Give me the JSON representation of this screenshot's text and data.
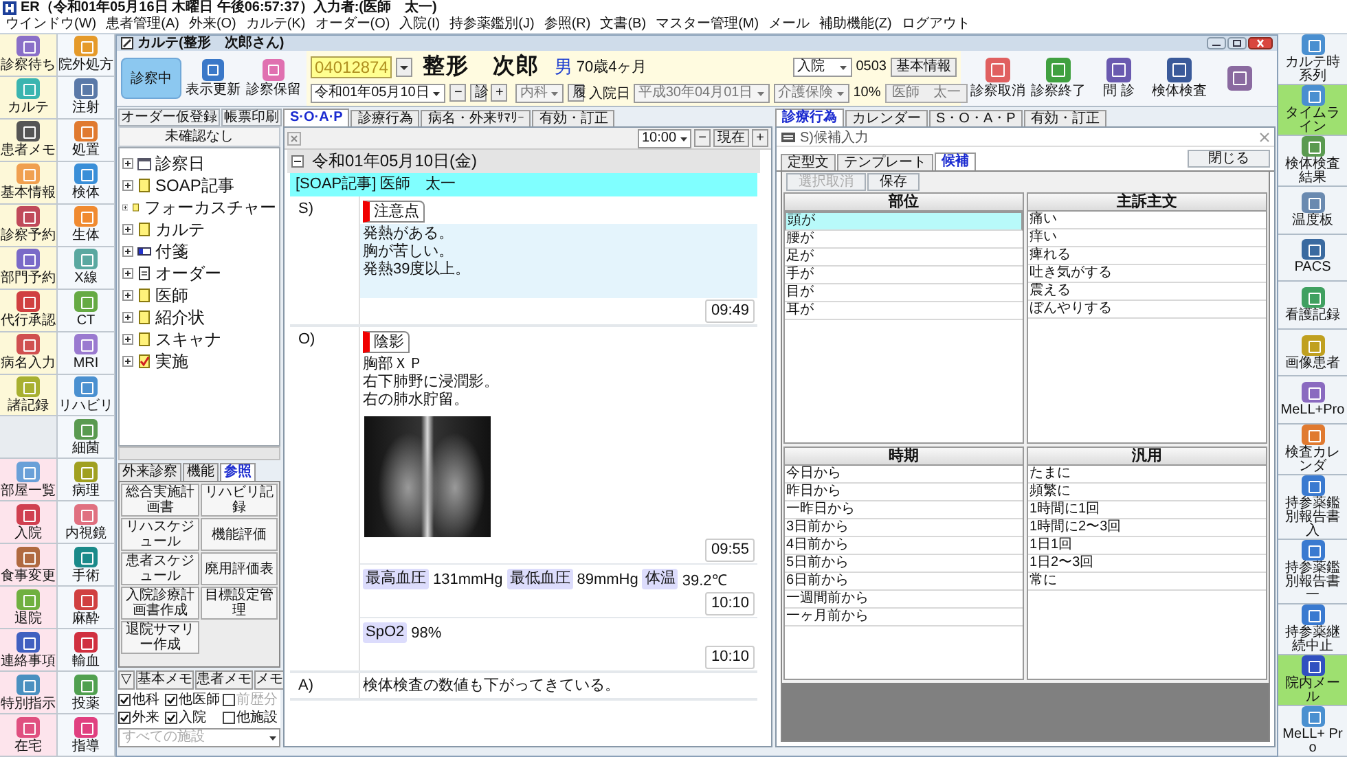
{
  "title_bar": {
    "title": "ER（令和01年05月16日 木曜日 午後06:57:37）入力者:(医師　太一)"
  },
  "menu": [
    "ウインドウ(W)",
    "患者管理(A)",
    "外来(O)",
    "カルテ(K)",
    "オーダー(O)",
    "入院(I)",
    "持参薬鑑別(J)",
    "参照(R)",
    "文書(B)",
    "マスター管理(M)",
    "メール",
    "補助機能(Z)",
    "ログアウト"
  ],
  "launcher_left": [
    {
      "label": "診察待ち",
      "kind": "outpatient",
      "color": "#8a6fc8"
    },
    {
      "label": "カルテ",
      "kind": "outpatient",
      "color": "#3bb5b0"
    },
    {
      "label": "患者メモ",
      "kind": "outpatient",
      "color": "#555555"
    },
    {
      "label": "基本情報",
      "kind": "outpatient",
      "color": "#f0a050"
    },
    {
      "label": "診察予約",
      "kind": "outpatient",
      "color": "#c04a5a"
    },
    {
      "label": "部門予約",
      "kind": "outpatient",
      "color": "#7a6ac8"
    },
    {
      "label": "代行承認",
      "kind": "outpatient",
      "color": "#d04040"
    },
    {
      "label": "病名入力",
      "kind": "outpatient",
      "color": "#d05050"
    },
    {
      "label": "諸記録",
      "kind": "outpatient",
      "color": "#a8b030"
    },
    {
      "kind": "blank"
    },
    {
      "label": "部屋一覧",
      "kind": "inpatient",
      "color": "#6aa0d8"
    },
    {
      "label": "入院",
      "kind": "inpatient",
      "color": "#d04050"
    },
    {
      "label": "食事変更",
      "kind": "inpatient",
      "color": "#b06a40"
    },
    {
      "label": "退院",
      "kind": "inpatient",
      "color": "#70b040"
    },
    {
      "label": "連絡事項",
      "kind": "inpatient",
      "color": "#4060c0"
    },
    {
      "label": "特別指示",
      "kind": "inpatient",
      "color": "#4a90c0"
    },
    {
      "label": "在宅",
      "kind": "inpatient",
      "color": "#e05080"
    },
    {
      "label": "院外処方",
      "kind": "order",
      "color": "#e59a2a"
    },
    {
      "label": "注射",
      "kind": "order",
      "color": "#5a79a8"
    },
    {
      "label": "処置",
      "kind": "order",
      "color": "#e07a30"
    },
    {
      "label": "検体",
      "kind": "order",
      "color": "#3a8fd8"
    },
    {
      "label": "生体",
      "kind": "order",
      "color": "#f08a30"
    },
    {
      "label": "X線",
      "kind": "order",
      "color": "#5aa8a0"
    },
    {
      "label": "CT",
      "kind": "order",
      "color": "#66aa44"
    },
    {
      "label": "MRI",
      "kind": "order",
      "color": "#9a7ad0"
    },
    {
      "label": "リハビリ",
      "kind": "order",
      "color": "#4a90d0"
    },
    {
      "label": "細菌",
      "kind": "order",
      "color": "#5a9a50"
    },
    {
      "label": "病理",
      "kind": "order",
      "color": "#a0a020"
    },
    {
      "label": "内視鏡",
      "kind": "order",
      "color": "#e07080"
    },
    {
      "label": "手術",
      "kind": "order",
      "color": "#1a8a8a"
    },
    {
      "label": "麻酔",
      "kind": "order",
      "color": "#d04040"
    },
    {
      "label": "輸血",
      "kind": "order",
      "color": "#d03040"
    },
    {
      "label": "投薬",
      "kind": "order",
      "color": "#50a050"
    },
    {
      "label": "指導",
      "kind": "order",
      "color": "#e04080"
    }
  ],
  "launcher_right": [
    {
      "label": "カルテ時系列",
      "color": "#4a8fd0",
      "highlighted": false
    },
    {
      "label": "タイムライン",
      "color": "#4a8fd0",
      "highlighted": true
    },
    {
      "label": "検体検査結果",
      "color": "#5a9a50",
      "highlighted": false
    },
    {
      "label": "温度板",
      "color": "#6a8ab0",
      "highlighted": false
    },
    {
      "label": "PACS",
      "color": "#3a6aa0",
      "highlighted": false
    },
    {
      "label": "看護記録",
      "color": "#40a060",
      "highlighted": false
    },
    {
      "label": "画像患者",
      "color": "#c0a020",
      "highlighted": false
    },
    {
      "label": "MeLL+Pro",
      "color": "#8a6ac0",
      "highlighted": false
    },
    {
      "label": "検査カレンダ",
      "color": "#e07a30",
      "highlighted": false
    },
    {
      "label": "持参薬鑑別報告書入",
      "color": "#3a7ad0",
      "highlighted": false
    },
    {
      "label": "持参薬鑑別報告書一",
      "color": "#3a7ad0",
      "highlighted": false
    },
    {
      "label": "持参薬継続中止",
      "color": "#3a7ad0",
      "highlighted": false
    },
    {
      "label": "院内メール",
      "color": "#3050c0",
      "highlighted": true
    },
    {
      "label": "MeLL+ Pro",
      "color": "#4a90d0",
      "highlighted": false
    }
  ],
  "chart_window": {
    "title": "カルテ(整形　次郎さん)"
  },
  "header": {
    "status_button": "診察中",
    "buttons": [
      {
        "label": "表示更新",
        "color": "#3a78c8"
      },
      {
        "label": "診察保留",
        "color": "#e070b0"
      }
    ],
    "patient_id": "04012874",
    "name": "整形　次郎",
    "sex": "男",
    "age": "70歳4ヶ月",
    "ward": "入院",
    "room": "0503",
    "info_button": "基本情報",
    "visit_date": "令和01年05月10日",
    "minus": "−",
    "visit_button": "診",
    "plus": "+",
    "department": "内科",
    "history_button": "履",
    "admission_label": "入院日",
    "admission_date": "平成30年04月01日",
    "insurance": "介護保険",
    "copay": "10%",
    "doctor": "医師　太一"
  },
  "toolbar": [
    {
      "label": "診察取消",
      "color": "#e06060"
    },
    {
      "label": "診察終了",
      "color": "#40a040"
    },
    {
      "label": "問 診",
      "color": "#6a5ab0"
    },
    {
      "label": "検体検査",
      "color": "#3a5a9a"
    },
    {
      "color": "#8a6aa0"
    }
  ],
  "left_panel": {
    "buttons": [
      "オーダー仮登録",
      "帳票印刷"
    ],
    "notice": "未確認なし",
    "tree": [
      {
        "label": "診察日",
        "kind": "calendar",
        "expanded": false
      },
      {
        "label": "SOAP記事",
        "kind": "folder",
        "expanded": false
      },
      {
        "label": "フォーカスチャー",
        "kind": "folder",
        "expanded": false
      },
      {
        "label": "カルテ",
        "kind": "folder",
        "expanded": false
      },
      {
        "label": "付箋",
        "kind": "tag",
        "expanded": false
      },
      {
        "label": "オーダー",
        "kind": "page",
        "expanded": false
      },
      {
        "label": "医師",
        "kind": "folder",
        "expanded": false
      },
      {
        "label": "紹介状",
        "kind": "folder",
        "expanded": false
      },
      {
        "label": "スキャナ",
        "kind": "folder",
        "expanded": false
      },
      {
        "label": "実施",
        "kind": "check",
        "expanded": false
      }
    ],
    "tabs": [
      {
        "label": "外来診察",
        "selected": false
      },
      {
        "label": "機能",
        "selected": false
      },
      {
        "label": "参照",
        "selected": true
      }
    ],
    "shortcuts": [
      "総合実施計画書",
      "リハビリ記録",
      "リハスケジュール",
      "機能評価",
      "患者スケジュール",
      "廃用評価表",
      "入院診療計画書作成",
      "目標設定管理",
      "退院サマリー作成"
    ],
    "memo_tabs": [
      "▽",
      "基本メモ",
      "患者メモ",
      "メモ"
    ],
    "filters": [
      {
        "label": "他科",
        "checked": true,
        "disabled": false
      },
      {
        "label": "他医師",
        "checked": true,
        "disabled": false
      },
      {
        "label": "前歴分",
        "checked": false,
        "disabled": true
      },
      {
        "label": "外来",
        "checked": true,
        "disabled": false
      },
      {
        "label": "入院",
        "checked": true,
        "disabled": false
      },
      {
        "label": "他施設",
        "checked": false,
        "disabled": false
      }
    ],
    "facility": {
      "placeholder": "すべての施設"
    }
  },
  "center": {
    "tabs": [
      {
        "label": "S·O·A·P",
        "selected": true
      },
      {
        "label": "診療行為",
        "selected": false
      },
      {
        "label": "病名・外来ｻﾏﾘｰ",
        "selected": false
      },
      {
        "label": "有効・訂正",
        "selected": false
      }
    ],
    "time": "10:00",
    "minus": "−",
    "now": "現在",
    "plus": "+",
    "date_group": {
      "date": "令和01年05月10日(金)",
      "expanded": true
    },
    "entry_header": "[SOAP記事] 医師　太一",
    "sections": [
      {
        "label": "S)",
        "blocks": [
          {
            "kind": "note",
            "tag": "注意点",
            "lines": [
              "発熱がある。",
              "胸が苦しい。",
              "発熱39度以上。"
            ],
            "highlighted": true,
            "image": false,
            "time": "09:49"
          }
        ]
      },
      {
        "label": "O)",
        "blocks": [
          {
            "kind": "note",
            "tag": "陰影",
            "lines": [
              "胸部ＸＰ",
              "右下肺野に浸潤影。",
              "右の肺水貯留。"
            ],
            "highlighted": false,
            "image": true,
            "time": "09:55"
          },
          {
            "kind": "vitals",
            "items": [
              {
                "name": "最高血圧",
                "value": "131mmHg"
              },
              {
                "name": "最低血圧",
                "value": "89mmHg"
              },
              {
                "name": "体温",
                "value": "39.2℃"
              }
            ],
            "time": "10:10"
          },
          {
            "kind": "vitals",
            "items": [
              {
                "name": "SpO2",
                "value": "98%"
              }
            ],
            "time": "10:10"
          }
        ]
      },
      {
        "label": "A)",
        "blocks": [
          {
            "kind": "text",
            "lines": [
              "検体検査の数値も下がってきている。"
            ]
          }
        ]
      }
    ]
  },
  "right_panel": {
    "tabs": [
      {
        "label": "診療行為",
        "selected": true
      },
      {
        "label": "カレンダー",
        "selected": false
      },
      {
        "label": "S・O・A・P",
        "selected": false
      },
      {
        "label": "有効・訂正",
        "selected": false
      }
    ],
    "dialog_title": "S)候補入力",
    "dialog_tabs": [
      {
        "label": "定型文",
        "selected": false
      },
      {
        "label": "テンプレート",
        "selected": false
      },
      {
        "label": "候補",
        "selected": true
      }
    ],
    "close_button": "閉じる",
    "actions": [
      {
        "label": "選択取消",
        "disabled": true
      },
      {
        "label": "保存",
        "disabled": false
      }
    ],
    "lists": [
      {
        "title": "部位",
        "items": [
          {
            "label": "頭が",
            "selected": true
          },
          {
            "label": "腰が",
            "selected": false
          },
          {
            "label": "足が",
            "selected": false
          },
          {
            "label": "手が",
            "selected": false
          },
          {
            "label": "目が",
            "selected": false
          },
          {
            "label": "耳が",
            "selected": false
          }
        ]
      },
      {
        "title": "主訴主文",
        "items": [
          {
            "label": "痛い",
            "selected": false
          },
          {
            "label": "痒い",
            "selected": false
          },
          {
            "label": "痺れる",
            "selected": false
          },
          {
            "label": "吐き気がする",
            "selected": false
          },
          {
            "label": "震える",
            "selected": false
          },
          {
            "label": "ぼんやりする",
            "selected": false
          }
        ]
      },
      {
        "title": "時期",
        "items": [
          {
            "label": "今日から",
            "selected": false
          },
          {
            "label": "昨日から",
            "selected": false
          },
          {
            "label": "一昨日から",
            "selected": false
          },
          {
            "label": "3日前から",
            "selected": false
          },
          {
            "label": "4日前から",
            "selected": false
          },
          {
            "label": "5日前から",
            "selected": false
          },
          {
            "label": "6日前から",
            "selected": false
          },
          {
            "label": "一週間前から",
            "selected": false
          },
          {
            "label": "一ヶ月前から",
            "selected": false
          }
        ]
      },
      {
        "title": "汎用",
        "items": [
          {
            "label": "たまに",
            "selected": false
          },
          {
            "label": "頻繁に",
            "selected": false
          },
          {
            "label": "1時間に1回",
            "selected": false
          },
          {
            "label": "1時間に2〜3回",
            "selected": false
          },
          {
            "label": "1日1回",
            "selected": false
          },
          {
            "label": "1日2〜3回",
            "selected": false
          },
          {
            "label": "常に",
            "selected": false
          }
        ]
      }
    ]
  }
}
